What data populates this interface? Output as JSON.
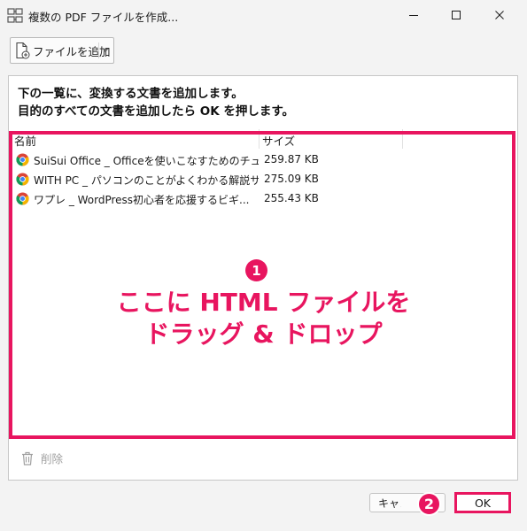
{
  "window": {
    "title": "複数の PDF ファイルを作成...",
    "app_icon": "pdf-combine-icon",
    "controls": [
      "minimize-icon",
      "maximize-icon",
      "close-icon"
    ]
  },
  "toolbar": {
    "add_file_label": "ファイルを追加",
    "add_file_icon": "add-file-icon"
  },
  "instruction": {
    "line1": "下の一覧に、変換する文書を追加します。",
    "line2": "目的のすべての文書を追加したら OK を押します。"
  },
  "list": {
    "columns": {
      "name": "名前",
      "size": "サイズ"
    },
    "rows": [
      {
        "name": "SuiSui Office _ Officeを使いこなすためのチュ...",
        "size": "259.87 KB",
        "icon": "chrome-icon"
      },
      {
        "name": "WITH PC _ パソコンのことがよくわかる解説サ...",
        "size": "275.09 KB",
        "icon": "chrome-icon"
      },
      {
        "name": "ワプレ _ WordPress初心者を応援するビギ...",
        "size": "255.43 KB",
        "icon": "chrome-icon"
      }
    ]
  },
  "annotation": {
    "badge1": "1",
    "line1": "ここに HTML ファイルを",
    "line2": "ドラッグ & ドロップ",
    "badge2": "2",
    "color": "#e8155f"
  },
  "footer": {
    "delete_label": "削除",
    "cancel_label": "キャンセル",
    "ok_label": "OK"
  }
}
